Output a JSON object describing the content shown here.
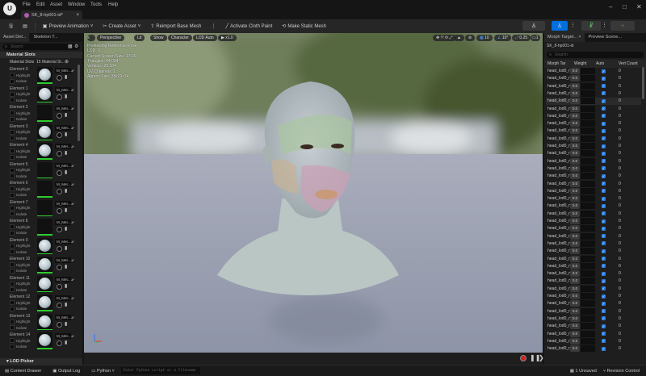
{
  "app": {
    "logo": "UE",
    "menu": [
      "File",
      "Edit",
      "Asset",
      "Window",
      "Tools",
      "Help"
    ],
    "tab": "SK_8-hp001-id*",
    "window_controls": [
      "minimize-icon",
      "maximize-icon",
      "close-icon"
    ]
  },
  "toolbar": {
    "preview_animation": "Preview Animation",
    "create_asset": "Create Asset",
    "reimport": "Reimport Base Mesh",
    "activate_cloth": "Activate Cloth Paint",
    "make_static": "Make Static Mesh",
    "accent": "#0070e0"
  },
  "left_panel": {
    "tabs": [
      "Asset Det...",
      "Skeleton T..."
    ],
    "search_placeholder": "Search",
    "section": "Material Slots",
    "slots_label": "Material Slots",
    "slots_value": "15 Material Sl...",
    "highlight": "Highlight",
    "isolate": "Isolate",
    "material_name": "M_Met...",
    "elements": [
      "Element 0",
      "Element 1",
      "Element 2",
      "Element 3",
      "Element 4",
      "Element 5",
      "Element 6",
      "Element 7",
      "Element 8",
      "Element 9",
      "Element 10",
      "Element 11",
      "Element 12",
      "Element 13",
      "Element 14"
    ],
    "dark_elements": [
      2,
      5,
      6,
      7,
      8
    ],
    "lod_picker": "LOD Picker"
  },
  "viewport": {
    "pills": [
      "Perspective",
      "Lit",
      "Show",
      "Character",
      "LOD Auto",
      "x1.0"
    ],
    "info": [
      "Previewing Reference Pose",
      "LOD: 0",
      "Current Screen Size: 1.516",
      "Triangles: 44,094",
      "Vertices: 25,184",
      "UV Channels: 1",
      "Approx Size: 38x22x74"
    ],
    "right_controls": {
      "grid": "10",
      "angle": "10°",
      "scale": "0.25",
      "camera": "1"
    }
  },
  "right_panel": {
    "tabs": [
      "Morph Target...",
      "Preview Scene..."
    ],
    "asset": "SK_8-hp001-id",
    "search_placeholder": "Search",
    "columns": [
      "Morph Tar",
      "Weight",
      "Auto",
      "Vert Count"
    ],
    "row_name": "head_lod0_m",
    "row_weight": "0.0",
    "row_vert": "0",
    "row_count": 38
  },
  "status_bar": {
    "content_drawer": "Content Drawer",
    "output_log": "Output Log",
    "python": "Python",
    "cmd_placeholder": "Enter Python script or a filename",
    "unsaved": "1 Unsaved",
    "revision": "Revision Control"
  }
}
